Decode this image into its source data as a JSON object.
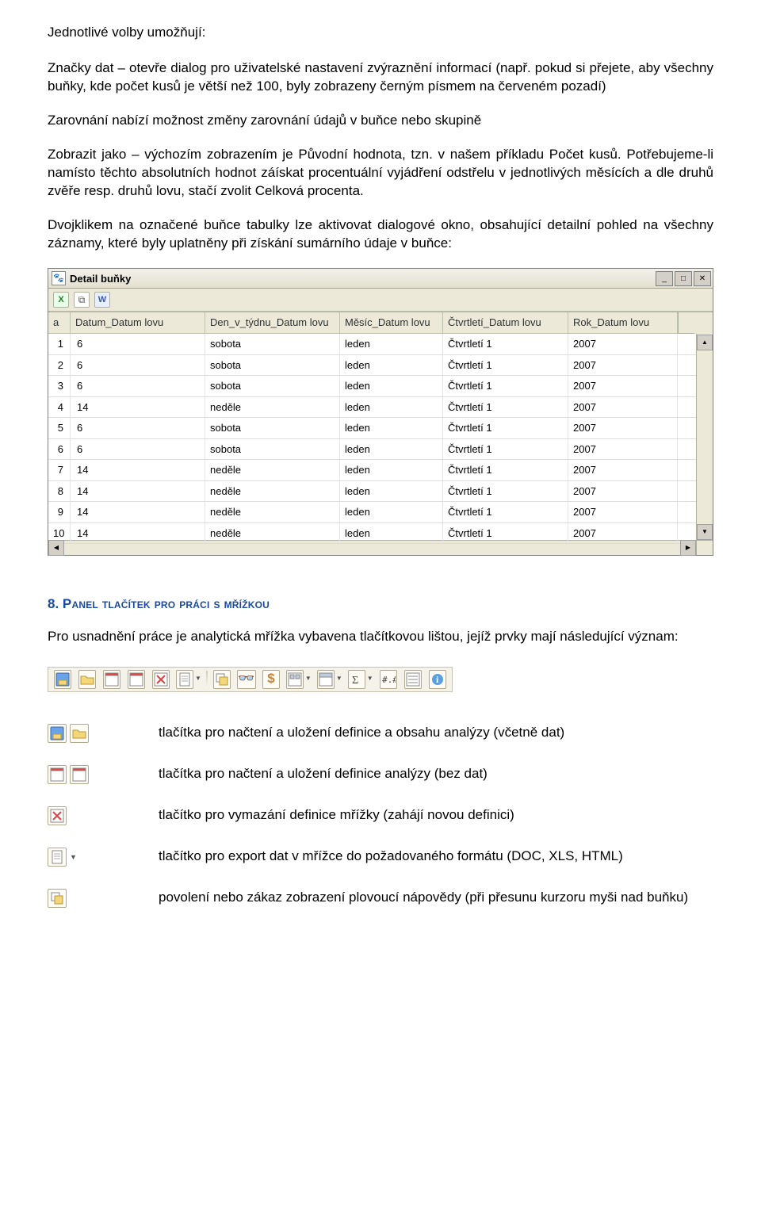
{
  "intro": {
    "line1": "Jednotlivé volby umožňují:",
    "p1": "Značky dat – otevře dialog pro uživatelské nastavení zvýraznění informací (např. pokud si přejete, aby všechny buňky, kde počet kusů je větší než 100, byly zobrazeny černým písmem na červeném pozadí)",
    "p2": "Zarovnání nabízí možnost změny zarovnání údajů v buňce nebo skupině",
    "p3": "Zobrazit jako – výchozím zobrazením je Původní hodnota, tzn. v našem příkladu Počet kusů. Potřebujeme-li namísto těchto absolutních hodnot záískat procentuální vyjádření odstřelu v jednotlivých měsících a dle druhů zvěře resp. druhů lovu, stačí zvolit Celková procenta.",
    "p4": "Dvojklikem na označené buňce tabulky lze aktivovat dialogové okno, obsahující detailní pohled na všechny záznamy, které byly uplatněny při získání sumárního údaje v buňce:"
  },
  "dialog": {
    "title": "Detail buňky",
    "columns": [
      "a",
      "Datum_Datum lovu",
      "Den_v_týdnu_Datum lovu",
      "Měsíc_Datum lovu",
      "Čtvrtletí_Datum lovu",
      "Rok_Datum lovu"
    ],
    "rows": [
      {
        "a": "1",
        "b": "6",
        "c": "sobota",
        "d": "leden",
        "e": "Čtvrtletí 1",
        "f": "2007"
      },
      {
        "a": "2",
        "b": "6",
        "c": "sobota",
        "d": "leden",
        "e": "Čtvrtletí 1",
        "f": "2007"
      },
      {
        "a": "3",
        "b": "6",
        "c": "sobota",
        "d": "leden",
        "e": "Čtvrtletí 1",
        "f": "2007"
      },
      {
        "a": "4",
        "b": "14",
        "c": "neděle",
        "d": "leden",
        "e": "Čtvrtletí 1",
        "f": "2007"
      },
      {
        "a": "5",
        "b": "6",
        "c": "sobota",
        "d": "leden",
        "e": "Čtvrtletí 1",
        "f": "2007"
      },
      {
        "a": "6",
        "b": "6",
        "c": "sobota",
        "d": "leden",
        "e": "Čtvrtletí 1",
        "f": "2007"
      },
      {
        "a": "7",
        "b": "14",
        "c": "neděle",
        "d": "leden",
        "e": "Čtvrtletí 1",
        "f": "2007"
      },
      {
        "a": "8",
        "b": "14",
        "c": "neděle",
        "d": "leden",
        "e": "Čtvrtletí 1",
        "f": "2007"
      },
      {
        "a": "9",
        "b": "14",
        "c": "neděle",
        "d": "leden",
        "e": "Čtvrtletí 1",
        "f": "2007"
      },
      {
        "a": "10",
        "b": "14",
        "c": "neděle",
        "d": "leden",
        "e": "Čtvrtletí 1",
        "f": "2007"
      }
    ]
  },
  "section8": {
    "num": "8.",
    "title": "Panel tlačítek pro práci s mřížkou",
    "intro": "Pro usnadnění práce je analytická mřížka vybavena tlačítkovou lištou, jejíž prvky mají následující význam:"
  },
  "desc": {
    "d1": "tlačítka pro načtení a uložení definice a obsahu analýzy (včetně dat)",
    "d2": "tlačítka pro načtení a uložení definice analýzy (bez dat)",
    "d3": "tlačítko pro vymazání definice mřížky (zahájí novou definici)",
    "d4": "tlačítko pro export dat v mřížce do požadovaného formátu (DOC, XLS, HTML)",
    "d5": "povolení nebo zákaz zobrazení plovoucí nápovědy (při přesunu kurzoru myši nad buňku)"
  }
}
